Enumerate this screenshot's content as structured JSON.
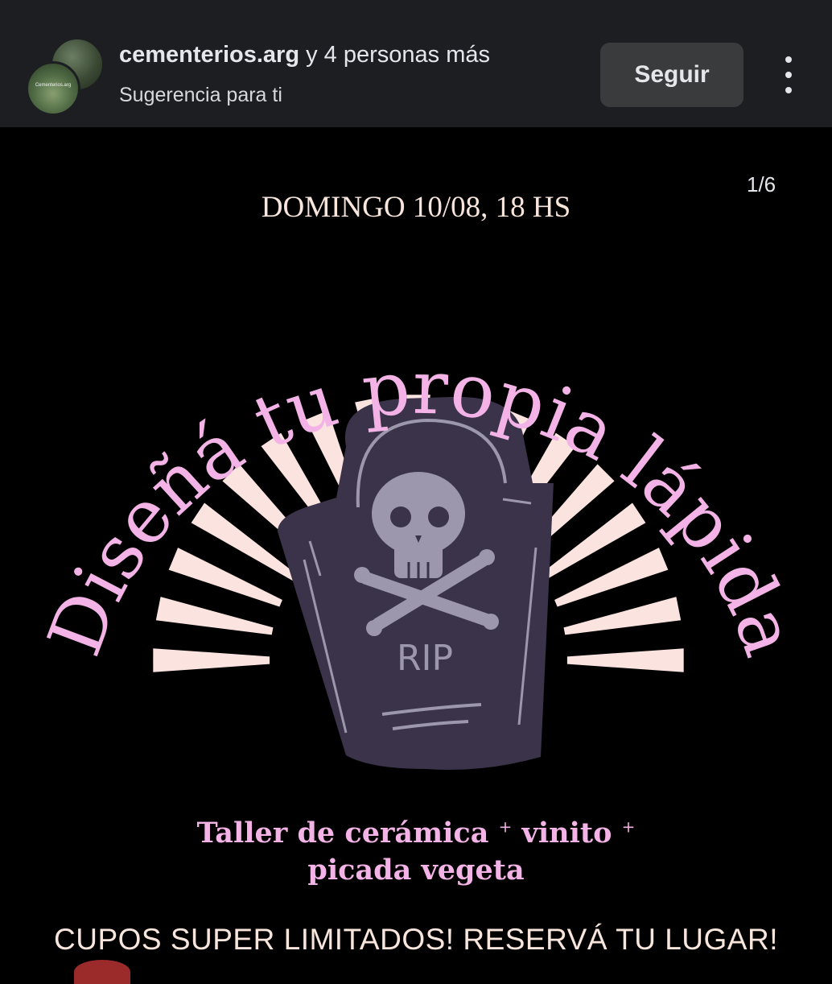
{
  "header": {
    "account_name": "cementerios.arg",
    "title_suffix": " y 4 personas más",
    "subtitle": "Sugerencia para ti",
    "avatar_label": "Cementerios.arg",
    "follow_label": "Seguir",
    "more_icon": "more-vertical-icon"
  },
  "post": {
    "page_indicator": "1/6",
    "event_date": "DOMINGO 10/08, 18 HS",
    "headline": "Diseñá tu propia lápida",
    "tombstone_text": "RIP",
    "workshop_line1": "Taller de cerámica",
    "workshop_plus1": "+",
    "workshop_line1b": "vinito",
    "workshop_plus2": "+",
    "workshop_line2": "picada vegeta",
    "cta": "CUPOS SUPER LIMITADOS!  RESERVÁ TU LUGAR!"
  },
  "colors": {
    "header_bg": "#1c1e21",
    "post_bg": "#000000",
    "headline_pink": "#f3b3e6",
    "ray_cream": "#fbe3e0",
    "tombstone": "#3a3349",
    "skull": "#9c97ac"
  }
}
